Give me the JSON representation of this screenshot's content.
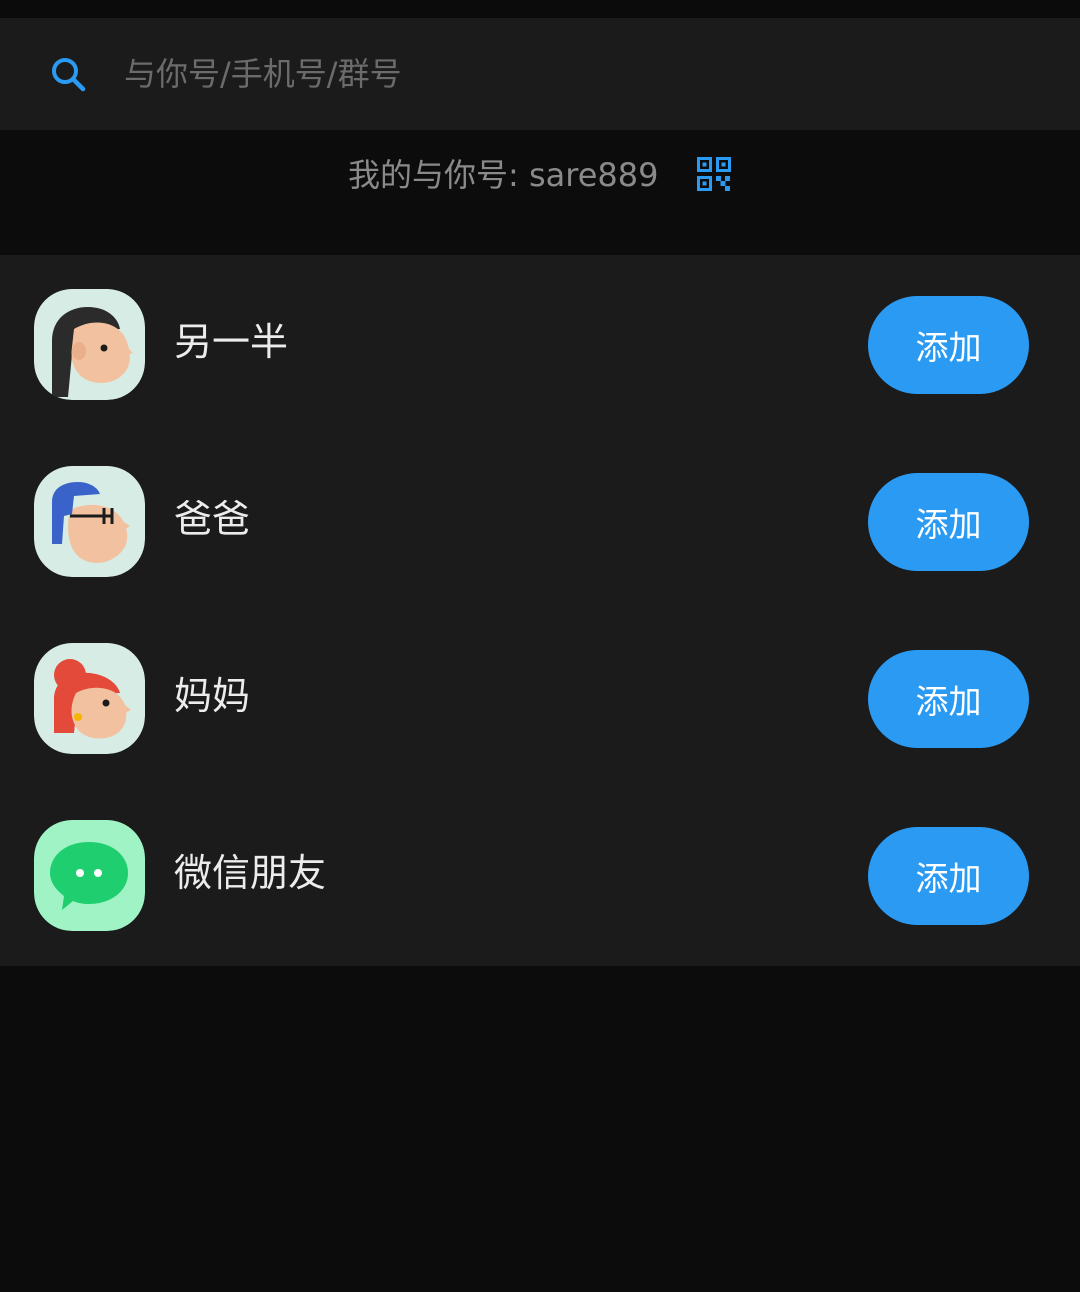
{
  "search": {
    "placeholder": "与你号/手机号/群号",
    "value": ""
  },
  "my_id": {
    "text": "我的与你号: sare889"
  },
  "contacts": [
    {
      "name": "另一半",
      "add_label": "添加",
      "avatar_icon": "woman-avatar-icon"
    },
    {
      "name": "爸爸",
      "add_label": "添加",
      "avatar_icon": "dad-avatar-icon"
    },
    {
      "name": "妈妈",
      "add_label": "添加",
      "avatar_icon": "mom-avatar-icon"
    },
    {
      "name": "微信朋友",
      "add_label": "添加",
      "avatar_icon": "wechat-icon"
    }
  ],
  "colors": {
    "accent": "#2b9af3",
    "background": "#0c0c0c",
    "panel": "#1b1b1b",
    "avatar_bg": "#d8ece6",
    "wechat_bg": "#9ff3c4",
    "wechat_bubble": "#1fcf6f"
  }
}
